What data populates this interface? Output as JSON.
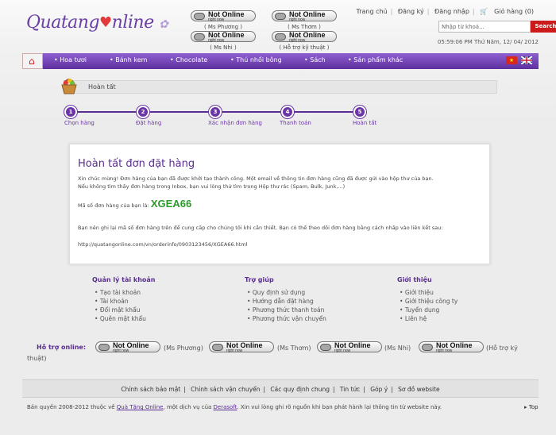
{
  "header": {
    "logo": "Quatang",
    "logo2": "nline",
    "yahoo": [
      {
        "status": "Not Online",
        "sub": "right now",
        "name": "( Ms Phương )"
      },
      {
        "status": "Not Online",
        "sub": "right now",
        "name": "( Ms Thơm )"
      },
      {
        "status": "Not Online",
        "sub": "right now",
        "name": "( Ms Nhi )"
      },
      {
        "status": "Not Online",
        "sub": "right now",
        "name": "( Hỗ trợ kỹ thuật )"
      }
    ],
    "links": [
      "Trang chủ",
      "Đăng ký",
      "Đăng nhập",
      "Giỏ hàng (0)"
    ],
    "search_placeholder": "Nhập từ khoá...",
    "search_button": "Search",
    "clock": "05:59:06 PM Thứ Năm, 12/ 04/ 2012"
  },
  "nav": [
    "Hoa tươi",
    "Bánh kem",
    "Chocolate",
    "Thú nhồi bông",
    "Sách",
    "Sản phẩm khác"
  ],
  "breadcrumb": "Hoàn tất",
  "steps": [
    {
      "num": "1",
      "label": "Chọn hàng"
    },
    {
      "num": "2",
      "label": "Đặt hàng"
    },
    {
      "num": "3",
      "label": "Xác nhận đơn hàng"
    },
    {
      "num": "4",
      "label": "Thanh toán"
    },
    {
      "num": "5",
      "label": "Hoàn tất"
    }
  ],
  "order": {
    "title": "Hoàn tất đơn đặt hàng",
    "msg1": "Xin chúc mừng! Đơn hàng của bạn đã được khởi tạo thành công. Một email về thông tin đơn hàng cũng đã được gửi vào hộp thư của bạn.",
    "msg2": "Nếu không tìm thấy đơn hàng trong Inbox, bạn vui lòng thử tìm trong Hộp thư rác (Spam, Bulk, Junk,...)",
    "code_label": "Mã số đơn hàng của bạn là:",
    "code": "XGEA66",
    "msg3": "Bạn nên ghi lại mã số đơn hàng trên để cung cấp cho chúng tôi khi cần thiết. Bạn có thể theo dõi đơn hàng bằng cách nhấp vào liên kết sau:",
    "url": "http://quatangonline.com/vn/orderinfo/0903123456/XGEA66.html"
  },
  "footer": {
    "cols": [
      {
        "title": "Quản lý tài khoản",
        "items": [
          "Tạo tài khoản",
          "Tài khoản",
          "Đổi mật khẩu",
          "Quên mật khẩu"
        ]
      },
      {
        "title": "Trợ giúp",
        "items": [
          "Quy định sử dụng",
          "Hướng dẫn đặt hàng",
          "Phương thức thanh toán",
          "Phương thức vận chuyển"
        ]
      },
      {
        "title": "Giới thiệu",
        "items": [
          "Giới thiệu",
          "Giới thiệu công ty",
          "Tuyển dụng",
          "Liên hệ"
        ]
      }
    ],
    "support_label": "Hỗ trợ online:",
    "support_names": [
      "(Ms Phương)",
      "(Ms Thơm)",
      "(Ms Nhi)",
      "(Hỗ trợ kỹ"
    ],
    "support_cont": "thuật)",
    "bottom_links": [
      "Chính sách bảo mật",
      "Chính sách vận chuyển",
      "Các quy định chung",
      "Tin tức",
      "Góp ý",
      "Sơ đồ website"
    ],
    "copy1": "Bản quyền 2008-2012 thuộc về ",
    "copy_link1": "Quà Tặng Online",
    "copy2": ", một dịch vụ của ",
    "copy_link2": "Derasoft",
    "copy3": ". Xin vui lòng ghi rõ nguồn khi bạn phát hành lại thông tin từ website này.",
    "top": "Top"
  }
}
